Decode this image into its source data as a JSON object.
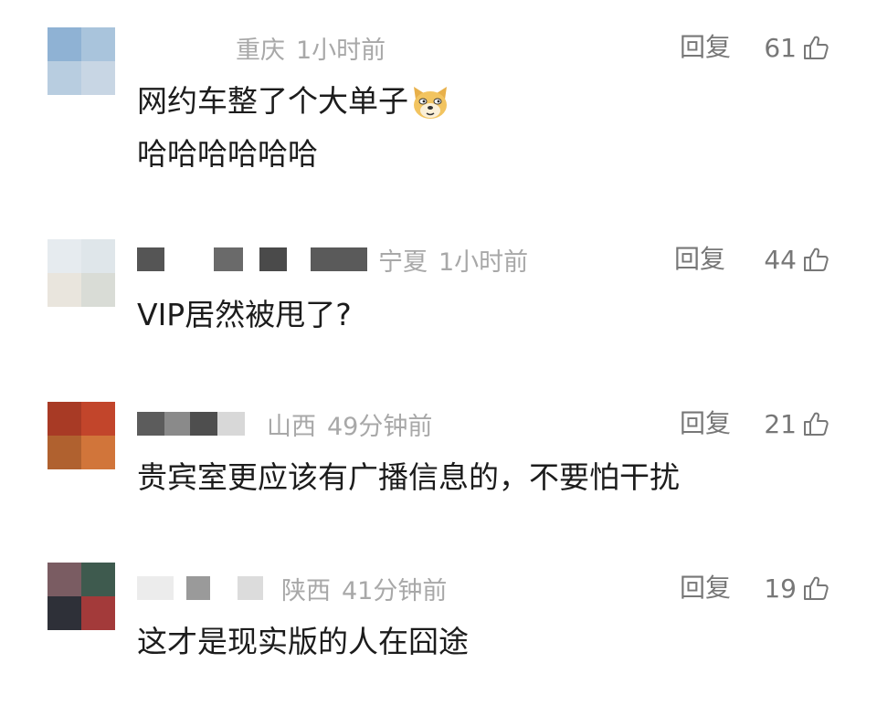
{
  "comments": [
    {
      "location": "重庆",
      "time": "1小时前",
      "reply_label": "回复",
      "likes": "61",
      "text_lines": [
        "网约车整了个大单子",
        "哈哈哈哈哈哈"
      ],
      "emoji": "doge-emoji",
      "avatar_colors": [
        "#8fb2d4",
        "#a9c4dc",
        "#b8cde0",
        "#c8d6e4"
      ]
    },
    {
      "location": "宁夏",
      "time": "1小时前",
      "reply_label": "回复",
      "likes": "44",
      "text_lines": [
        "VIP居然被甩了?"
      ],
      "avatar_colors": [
        "#e6ebef",
        "#dfe6ea",
        "#e9e5dd",
        "#d9dcd6"
      ]
    },
    {
      "location": "山西",
      "time": "49分钟前",
      "reply_label": "回复",
      "likes": "21",
      "text_lines": [
        "贵宾室更应该有广播信息的，不要怕干扰"
      ],
      "avatar_colors": [
        "#a83a25",
        "#c2452b",
        "#b0612f",
        "#d1753a"
      ]
    },
    {
      "location": "陕西",
      "time": "41分钟前",
      "reply_label": "回复",
      "likes": "19",
      "text_lines": [
        "这才是现实版的人在囧途"
      ],
      "avatar_colors": [
        "#7a5c62",
        "#3e5a4e",
        "#2e3038",
        "#a33a3a"
      ]
    }
  ],
  "colors": {
    "meta_gray": "#a8a8a8",
    "action_gray": "#777777",
    "text": "#1c1c1c"
  }
}
